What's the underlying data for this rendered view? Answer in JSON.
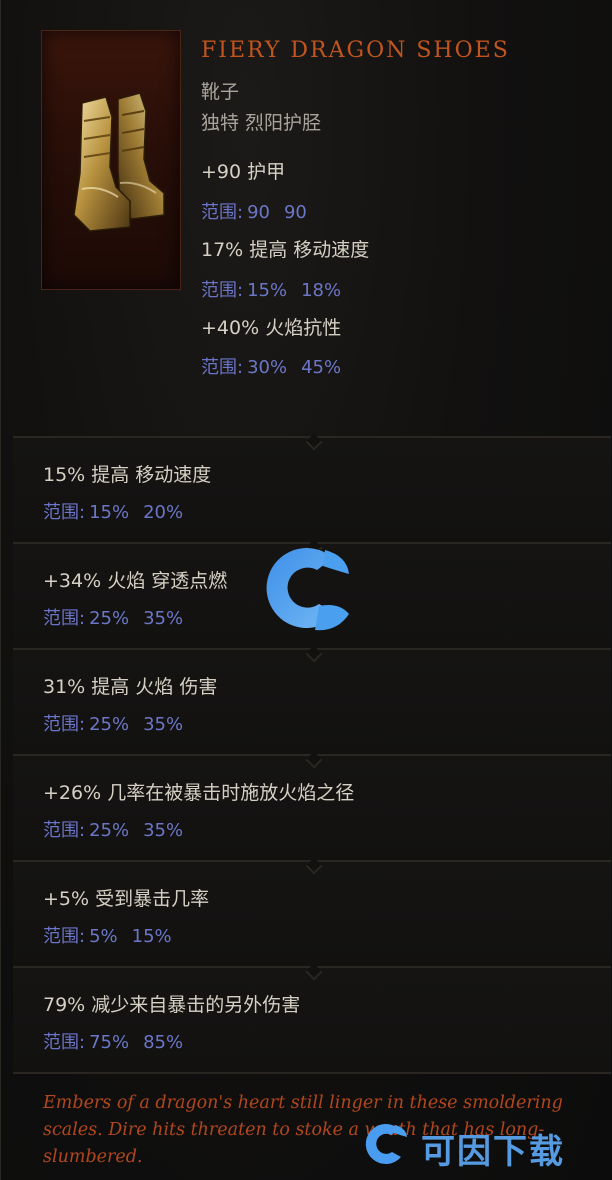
{
  "item": {
    "name": "FIERY DRAGON SHOES",
    "type": "靴子",
    "rarity": "独特 烈阳护胫",
    "icon": "greaves-icon",
    "name_color": "#c0551f"
  },
  "range_label": "范围:",
  "base_stats": [
    {
      "text": "+90 护甲",
      "range_min": "90",
      "range_max": "90"
    },
    {
      "text": "17% 提高 移动速度",
      "range_min": "15%",
      "range_max": "18%"
    },
    {
      "text": "+40% 火焰抗性",
      "range_min": "30%",
      "range_max": "45%"
    }
  ],
  "affixes": [
    {
      "text": "15% 提高 移动速度",
      "range_min": "15%",
      "range_max": "20%"
    },
    {
      "text": "+34% 火焰 穿透点燃",
      "range_min": "25%",
      "range_max": "35%"
    },
    {
      "text": "31% 提高 火焰 伤害",
      "range_min": "25%",
      "range_max": "35%"
    },
    {
      "text": "+26% 几率在被暴击时施放火焰之径",
      "range_min": "25%",
      "range_max": "35%"
    },
    {
      "text": "+5% 受到暴击几率",
      "range_min": "5%",
      "range_max": "15%"
    },
    {
      "text": "79% 减少来自暴击的另外伤害",
      "range_min": "75%",
      "range_max": "85%"
    }
  ],
  "flavor_text": "Embers of a dragon's heart still linger in these smoldering scales. Dire hits threaten to stoke a wrath that has long-slumbered.",
  "watermark": {
    "text": "可因下载",
    "icon": "c-logo-icon",
    "color": "#4a9cf0"
  },
  "colors": {
    "range": "#6b77c6",
    "flavor": "#b1471d",
    "stat": "#d6d0c4"
  }
}
